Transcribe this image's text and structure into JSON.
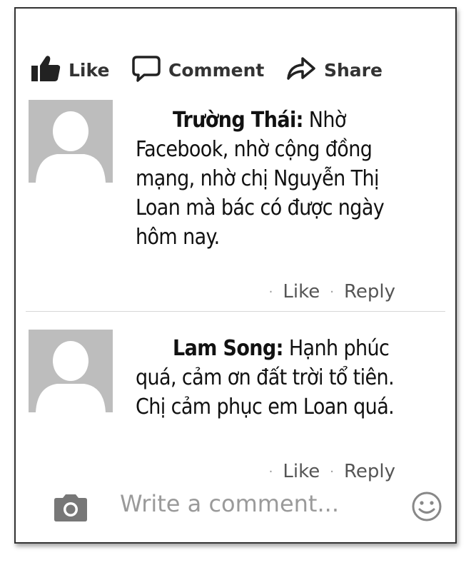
{
  "actions": {
    "like_label": "Like",
    "comment_label": "Comment",
    "share_label": "Share"
  },
  "comments": [
    {
      "author": "Trường Thái:",
      "lines": [
        " Nhờ",
        "Facebook, nhờ cộng đồng",
        "mạng, nhờ chị Nguyễn Thị",
        "Loan mà bác có được ngày",
        "hôm nay."
      ],
      "like_label": "Like",
      "reply_label": "Reply"
    },
    {
      "author": "Lam Song:",
      "lines": [
        " Hạnh phúc",
        "quá, cảm ơn đất trời tổ tiên.",
        "Chị cảm phục em Loan quá."
      ],
      "like_label": "Like",
      "reply_label": "Reply"
    }
  ],
  "write_comment": {
    "placeholder": "Write a comment..."
  },
  "icons": {
    "like": "thumbs-up-icon",
    "comment": "speech-bubble-icon",
    "share": "share-arrow-icon",
    "camera": "camera-icon",
    "emoji": "smiley-icon"
  }
}
